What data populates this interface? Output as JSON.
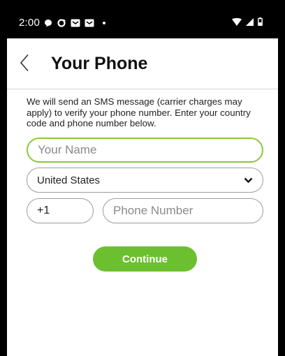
{
  "status_bar": {
    "time": "2:00",
    "left_icons": [
      "chat-bubble-icon",
      "sync-icon",
      "mail-icon",
      "mail-icon",
      "dot-icon"
    ],
    "right_icons": [
      "wifi-icon",
      "signal-icon",
      "battery-icon"
    ]
  },
  "header": {
    "back_icon": "chevron-left-icon",
    "title": "Your Phone"
  },
  "intro_text": "We will send an SMS message (carrier charges may apply) to verify your phone number. Enter your country code and phone number below.",
  "form": {
    "name_placeholder": "Your Name",
    "name_value": "",
    "country_selected": "United States",
    "country_code": "+1",
    "phone_placeholder": "Phone Number",
    "phone_value": ""
  },
  "continue_label": "Continue",
  "colors": {
    "accent": "#6cc02f",
    "focus_border": "#8dc63f",
    "field_border": "#9d9d9d",
    "status_bar": "#000000"
  }
}
